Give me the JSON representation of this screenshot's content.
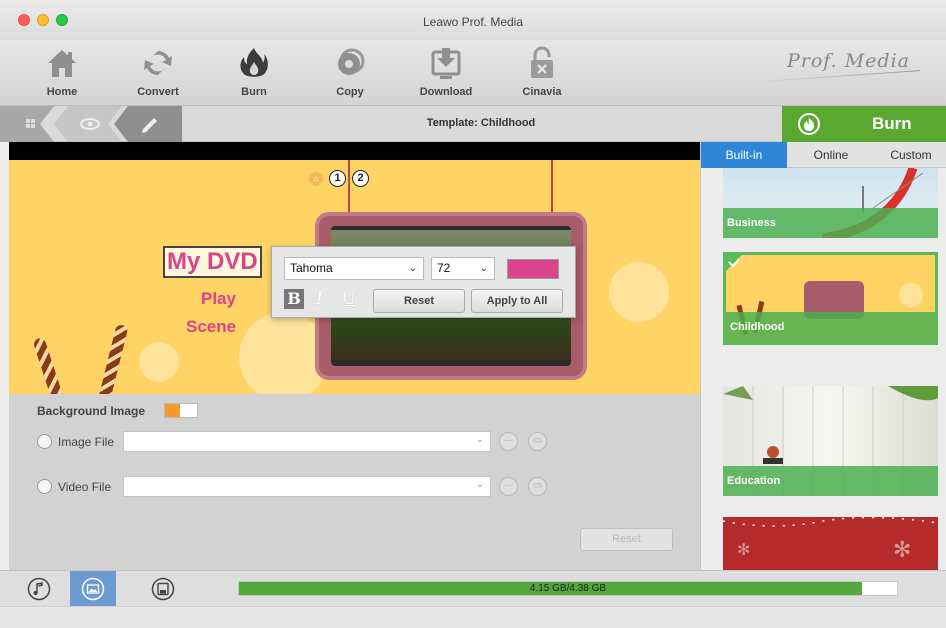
{
  "window": {
    "title": "Leawo Prof. Media"
  },
  "toolbar": {
    "items": [
      {
        "label": "Home",
        "icon": "home-icon"
      },
      {
        "label": "Convert",
        "icon": "convert-icon"
      },
      {
        "label": "Burn",
        "icon": "burn-icon"
      },
      {
        "label": "Copy",
        "icon": "copy-icon"
      },
      {
        "label": "Download",
        "icon": "download-icon"
      },
      {
        "label": "Cinavia",
        "icon": "cinavia-icon"
      }
    ],
    "brand": "Prof. Media"
  },
  "navbar": {
    "template_title": "Template: Childhood",
    "burn_label": "Burn"
  },
  "preview": {
    "pages": [
      "1",
      "2"
    ],
    "menu_title": "My DVD",
    "menu_play": "Play",
    "menu_scene": "Scene"
  },
  "font_popup": {
    "font": "Tahoma",
    "size": "72",
    "color": "#d9448a",
    "bold_label": "B",
    "italic_label": "I",
    "underline_label": "U",
    "reset_label": "Reset",
    "apply_all_label": "Apply to All"
  },
  "settings": {
    "background_label": "Background Image",
    "image_file_label": "Image File",
    "video_file_label": "Video File",
    "image_file_value": "",
    "video_file_value": "",
    "reset_label": "Reset"
  },
  "templates": {
    "tabs": [
      "Built-in",
      "Online",
      "Custom"
    ],
    "active_tab": "Built-in",
    "items": [
      {
        "name": "Business"
      },
      {
        "name": "Childhood",
        "selected": true
      },
      {
        "name": "Education"
      },
      {
        "name": ""
      }
    ]
  },
  "bottom": {
    "progress_text": "4.15 GB/4.38 GB",
    "progress_fraction": 0.947
  },
  "colors": {
    "accent_green": "#5aa832",
    "tab_blue": "#2f86d8",
    "menu_pink": "#d9448a",
    "preview_yellow": "#ffd465"
  }
}
